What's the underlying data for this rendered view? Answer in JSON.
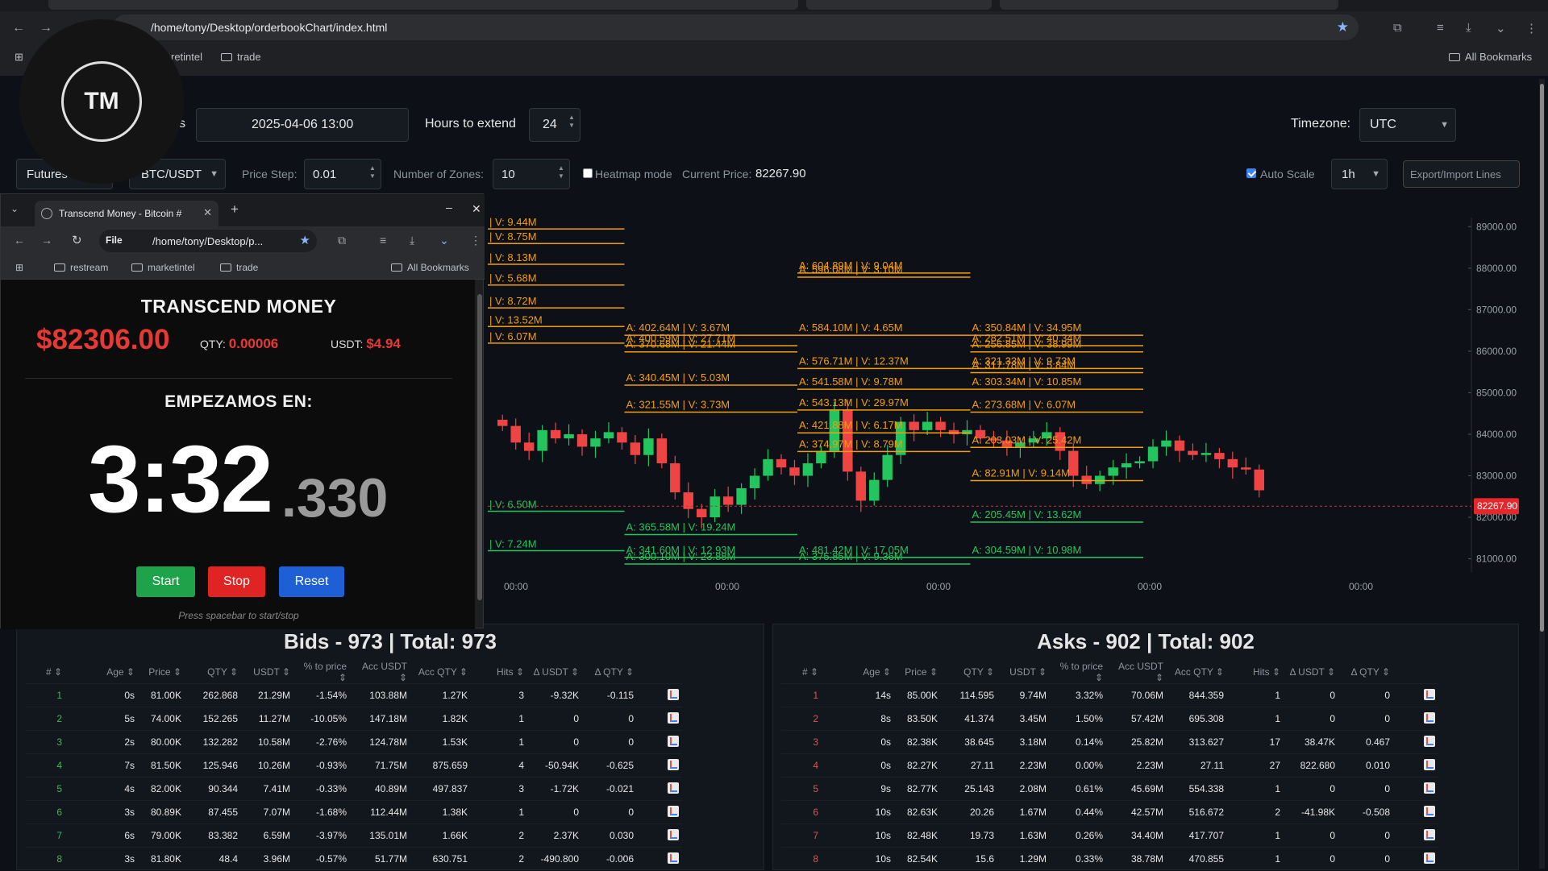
{
  "browser": {
    "url": "/home/tony/Desktop/orderbookChart/index.html",
    "bookmarks": [
      "restream",
      "marketintel",
      "trade"
    ],
    "bookmark_visible": [
      "retintel",
      "trade"
    ],
    "all_bookmarks": "All Bookmarks"
  },
  "logo": {
    "text": "TM"
  },
  "controls": {
    "dates_label_suffix": "s",
    "date_value": "2025-04-06 13:00",
    "hours_label": "Hours to extend",
    "hours_value": "24",
    "timezone_label": "Timezone:",
    "timezone_value": "UTC",
    "market_value": "Futures",
    "pair_value": "BTC/USDT",
    "price_step_label": "Price Step:",
    "price_step_value": "0.01",
    "zones_label": "Number of Zones:",
    "zones_value": "10",
    "heatmap_label": "Heatmap mode",
    "current_price_label": "Current Price:",
    "current_price_value": "82267.90",
    "auto_scale_label": "Auto Scale",
    "interval_value": "1h",
    "export_label": "Export/Import Lines"
  },
  "popup": {
    "tab_title": "Transcend Money - Bitcoin #",
    "omnibox_file": "File",
    "omnibox_path": "/home/tony/Desktop/p...",
    "bookmarks": [
      "restream",
      "marketintel",
      "trade"
    ],
    "all_bookmarks": "All Bookmarks",
    "app_title": "TRANSCEND MONEY",
    "price": "$82306.00",
    "qty_label": "QTY:",
    "qty_value": "0.00006",
    "usdt_label": "USDT:",
    "usdt_value": "$4.94",
    "countdown_label": "EMPEZAMOS EN:",
    "timer_main": "3:32",
    "timer_ms": ".330",
    "start_label": "Start",
    "stop_label": "Stop",
    "reset_label": "Reset",
    "hint": "Press spacebar to start/stop"
  },
  "chart_data": {
    "type": "candlestick",
    "price_axis": [
      "89000.00",
      "88000.00",
      "87000.00",
      "86000.00",
      "85000.00",
      "84000.00",
      "83000.00",
      "82000.00",
      "81000.00"
    ],
    "time_axis": [
      "00:00",
      "00:00",
      "00:00",
      "00:00",
      "00:00"
    ],
    "ylim": [
      80680,
      89220
    ],
    "current_price_tag": "82267.90",
    "close_series": [
      84200,
      83800,
      83600,
      84100,
      83900,
      84000,
      83700,
      83900,
      84050,
      83800,
      83500,
      83900,
      83300,
      82600,
      82200,
      82000,
      82500,
      82300,
      82700,
      83000,
      83400,
      83200,
      83000,
      83300,
      83600,
      84600,
      83100,
      82400,
      82900,
      83500,
      84300,
      84100,
      84300,
      84100,
      84000,
      84100,
      83900,
      83850,
      83700,
      83800,
      83900,
      84050,
      83600,
      83000,
      82800,
      83000,
      83200,
      83300,
      83350,
      83700,
      83850,
      83600,
      83500,
      83550,
      83400,
      83200,
      83150,
      82650
    ],
    "levels_left": [
      {
        "price": 89100,
        "text": "V: 9.44M",
        "color": "#f59e0b",
        "x_start": 0.0,
        "x_end": 0.115
      },
      {
        "price": 88750,
        "text": "V: 8.75M",
        "color": "#f59e0b",
        "x_start": 0.0,
        "x_end": 0.115
      },
      {
        "price": 88250,
        "text": "V: 8.13M",
        "color": "#f59e0b",
        "x_start": 0.0,
        "x_end": 0.115
      },
      {
        "price": 87750,
        "text": "V: 5.68M",
        "color": "#f59e0b",
        "x_start": 0.0,
        "x_end": 0.115
      },
      {
        "price": 87200,
        "text": "V: 8.72M",
        "color": "#f59e0b",
        "x_start": 0.0,
        "x_end": 0.115
      },
      {
        "price": 86750,
        "text": "V: 13.52M",
        "color": "#f59e0b",
        "x_start": 0.0,
        "x_end": 0.115
      },
      {
        "price": 86350,
        "text": "V: 6.07M",
        "color": "#f59e0b",
        "x_start": 0.0,
        "x_end": 0.115
      },
      {
        "price": 82300,
        "text": "V: 6.50M",
        "color": "#22c55e",
        "x_start": 0.0,
        "x_end": 0.115
      },
      {
        "price": 81350,
        "text": "V: 7.24M",
        "color": "#22c55e",
        "x_start": 0.0,
        "x_end": 0.115
      }
    ],
    "levels": [
      {
        "text": "A: 402.64M | V: 3.67M",
        "price": 86500,
        "color": "#f59e0b",
        "x_start": 0.115,
        "x_end": 0.28
      },
      {
        "text": "A: 400.59M | V: 27.71M",
        "price": 86250,
        "color": "#f59e0b",
        "x_start": 0.115,
        "x_end": 0.28
      },
      {
        "text": "A: 370.68M | V: 21.44M",
        "price": 86100,
        "color": "#f59e0b",
        "x_start": 0.115,
        "x_end": 0.28
      },
      {
        "text": "A: 340.45M | V: 5.03M",
        "price": 85300,
        "color": "#f59e0b",
        "x_start": 0.115,
        "x_end": 0.28
      },
      {
        "text": "A: 321.55M | V: 3.73M",
        "price": 84650,
        "color": "#f59e0b",
        "x_start": 0.115,
        "x_end": 0.28
      },
      {
        "text": "A: 365.58M | V: 19.24M",
        "price": 81700,
        "color": "#22c55e",
        "x_start": 0.115,
        "x_end": 0.28
      },
      {
        "text": "A: 341.60M | V: 12.93M",
        "price": 81150,
        "color": "#22c55e",
        "x_start": 0.115,
        "x_end": 0.28
      },
      {
        "text": "A: 300.10M | V: 23.88M",
        "price": 80990,
        "color": "#22c55e",
        "x_start": 0.115,
        "x_end": 0.28
      },
      {
        "text": "A: 604.89M | V: 9.04M",
        "price": 88000,
        "color": "#f59e0b",
        "x_start": 0.28,
        "x_end": 0.445
      },
      {
        "text": "A: 596.08M | V: 3.10M",
        "price": 87900,
        "color": "#f59e0b",
        "x_start": 0.28,
        "x_end": 0.445
      },
      {
        "text": "A: 584.10M | V: 4.65M",
        "price": 86500,
        "color": "#f59e0b",
        "x_start": 0.28,
        "x_end": 0.445
      },
      {
        "text": "A: 576.71M | V: 12.37M",
        "price": 85700,
        "color": "#f59e0b",
        "x_start": 0.28,
        "x_end": 0.445
      },
      {
        "text": "A: 541.58M | V: 9.78M",
        "price": 85200,
        "color": "#f59e0b",
        "x_start": 0.28,
        "x_end": 0.445
      },
      {
        "text": "A: 543.13M | V: 29.97M",
        "price": 84700,
        "color": "#f59e0b",
        "x_start": 0.28,
        "x_end": 0.445
      },
      {
        "text": "A: 421.88M | V: 6.17M",
        "price": 84150,
        "color": "#f59e0b",
        "x_start": 0.28,
        "x_end": 0.445
      },
      {
        "text": "A: 374.97M | V: 8.79M",
        "price": 83700,
        "color": "#f59e0b",
        "x_start": 0.28,
        "x_end": 0.445
      },
      {
        "text": "A: 481.42M | V: 17.05M",
        "price": 81150,
        "color": "#22c55e",
        "x_start": 0.28,
        "x_end": 0.445
      },
      {
        "text": "A: 375.85M | V: 9.36M",
        "price": 80990,
        "color": "#22c55e",
        "x_start": 0.28,
        "x_end": 0.445
      },
      {
        "text": "A: 350.84M | V: 34.95M",
        "price": 86500,
        "color": "#f59e0b",
        "x_start": 0.445,
        "x_end": 0.61
      },
      {
        "text": "A: 282.51M | V: 40.34M",
        "price": 86250,
        "color": "#f59e0b",
        "x_start": 0.445,
        "x_end": 0.61
      },
      {
        "text": "A: 256.85M | V: 38.99M",
        "price": 86100,
        "color": "#f59e0b",
        "x_start": 0.445,
        "x_end": 0.61
      },
      {
        "text": "A: 321.33M | V: 9.73M",
        "price": 85700,
        "color": "#f59e0b",
        "x_start": 0.445,
        "x_end": 0.61
      },
      {
        "text": "A: 317.78M | V: 5.84M",
        "price": 85600,
        "color": "#f59e0b",
        "x_start": 0.445,
        "x_end": 0.61
      },
      {
        "text": "A: 303.34M | V: 10.85M",
        "price": 85200,
        "color": "#f59e0b",
        "x_start": 0.445,
        "x_end": 0.61
      },
      {
        "text": "A: 273.68M | V: 6.07M",
        "price": 84650,
        "color": "#f59e0b",
        "x_start": 0.445,
        "x_end": 0.61
      },
      {
        "text": "A: 203.03M | V: 25.42M",
        "price": 83800,
        "color": "#f59e0b",
        "x_start": 0.445,
        "x_end": 0.61
      },
      {
        "text": "A: 82.91M | V: 9.14M",
        "price": 83000,
        "color": "#f59e0b",
        "x_start": 0.445,
        "x_end": 0.61
      },
      {
        "text": "A: 205.45M | V: 13.62M",
        "price": 82000,
        "color": "#22c55e",
        "x_start": 0.445,
        "x_end": 0.61
      },
      {
        "text": "A: 304.59M | V: 10.98M",
        "price": 81150,
        "color": "#22c55e",
        "x_start": 0.445,
        "x_end": 0.61
      }
    ]
  },
  "bids": {
    "title": "Bids - 973 | Total: 973",
    "columns": [
      "#",
      "Age",
      "Price",
      "QTY",
      "USDT",
      "% to price",
      "Acc USDT",
      "Acc QTY",
      "Hits",
      "Δ USDT",
      "Δ QTY",
      ""
    ],
    "rows": [
      [
        "1",
        "0s",
        "81.00K",
        "262.868",
        "21.29M",
        "-1.54%",
        "103.88M",
        "1.27K",
        "3",
        "-9.32K",
        "-0.115"
      ],
      [
        "2",
        "5s",
        "74.00K",
        "152.265",
        "11.27M",
        "-10.05%",
        "147.18M",
        "1.82K",
        "1",
        "0",
        "0"
      ],
      [
        "3",
        "2s",
        "80.00K",
        "132.282",
        "10.58M",
        "-2.76%",
        "124.78M",
        "1.53K",
        "1",
        "0",
        "0"
      ],
      [
        "4",
        "7s",
        "81.50K",
        "125.946",
        "10.26M",
        "-0.93%",
        "71.75M",
        "875.659",
        "4",
        "-50.94K",
        "-0.625"
      ],
      [
        "5",
        "4s",
        "82.00K",
        "90.344",
        "7.41M",
        "-0.33%",
        "40.89M",
        "497.837",
        "3",
        "-1.72K",
        "-0.021"
      ],
      [
        "6",
        "3s",
        "80.89K",
        "87.455",
        "7.07M",
        "-1.68%",
        "112.44M",
        "1.38K",
        "1",
        "0",
        "0"
      ],
      [
        "7",
        "6s",
        "79.00K",
        "83.382",
        "6.59M",
        "-3.97%",
        "135.01M",
        "1.66K",
        "2",
        "2.37K",
        "0.030"
      ],
      [
        "8",
        "3s",
        "81.80K",
        "48.4",
        "3.96M",
        "-0.57%",
        "51.77M",
        "630.751",
        "2",
        "-490.800",
        "-0.006"
      ]
    ]
  },
  "asks": {
    "title": "Asks - 902 | Total: 902",
    "columns": [
      "#",
      "Age",
      "Price",
      "QTY",
      "USDT",
      "% to price",
      "Acc USDT",
      "Acc QTY",
      "Hits",
      "Δ USDT",
      "Δ QTY",
      ""
    ],
    "rows": [
      [
        "1",
        "14s",
        "85.00K",
        "114.595",
        "9.74M",
        "3.32%",
        "70.06M",
        "844.359",
        "1",
        "0",
        "0"
      ],
      [
        "2",
        "8s",
        "83.50K",
        "41.374",
        "3.45M",
        "1.50%",
        "57.42M",
        "695.308",
        "1",
        "0",
        "0"
      ],
      [
        "3",
        "0s",
        "82.38K",
        "38.645",
        "3.18M",
        "0.14%",
        "25.82M",
        "313.627",
        "17",
        "38.47K",
        "0.467"
      ],
      [
        "4",
        "0s",
        "82.27K",
        "27.11",
        "2.23M",
        "0.00%",
        "2.23M",
        "27.11",
        "27",
        "822.680",
        "0.010"
      ],
      [
        "5",
        "9s",
        "82.77K",
        "25.143",
        "2.08M",
        "0.61%",
        "45.69M",
        "554.338",
        "1",
        "0",
        "0"
      ],
      [
        "6",
        "10s",
        "82.63K",
        "20.26",
        "1.67M",
        "0.44%",
        "42.57M",
        "516.672",
        "2",
        "-41.98K",
        "-0.508"
      ],
      [
        "7",
        "10s",
        "82.48K",
        "19.73",
        "1.63M",
        "0.26%",
        "34.40M",
        "417.707",
        "1",
        "0",
        "0"
      ],
      [
        "8",
        "10s",
        "82.54K",
        "15.6",
        "1.29M",
        "0.33%",
        "38.78M",
        "470.855",
        "1",
        "0",
        "0"
      ]
    ]
  },
  "colors": {
    "bull": "#22c55e",
    "bear": "#ef4444",
    "level_ask": "#f59e0b",
    "level_bid": "#22c55e",
    "price_tag": "#e5262b"
  }
}
